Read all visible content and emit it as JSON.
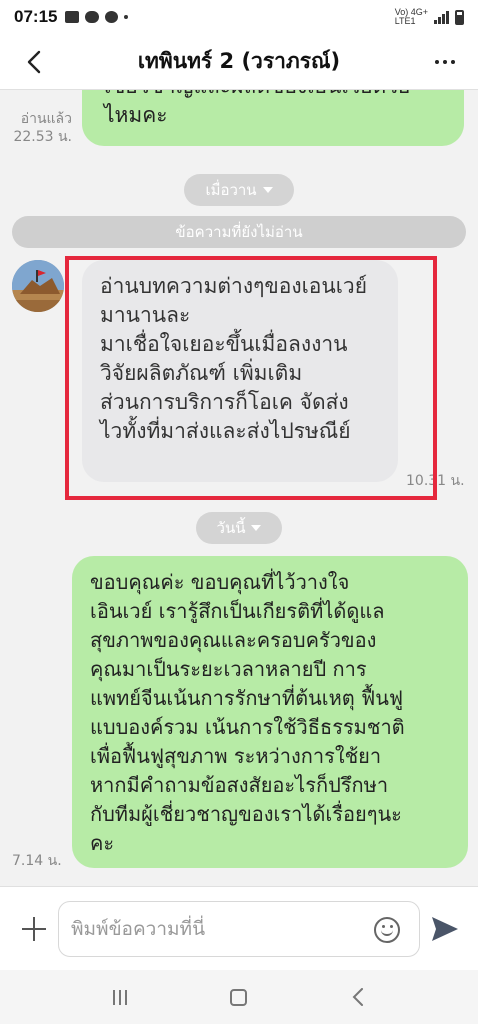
{
  "status_bar": {
    "time": "07:15",
    "network_label": "Vo) 4G+",
    "network_sub": "LTE1"
  },
  "header": {
    "title": "เทพินทร์ 2 (วราภรณ์)"
  },
  "messages": {
    "top_outgoing": {
      "text_line1": "เชี่ยวชาญและผลิตของเอนเวย์ด้วย",
      "text_line2": "ไหมคะ",
      "read_label": "อ่านแล้ว",
      "time": "22.53 น."
    },
    "date_yesterday": "เมื่อวาน",
    "unread_label": "ข้อความที่ยังไม่อ่าน",
    "incoming": {
      "lines": [
        "อ่านบทความต่างๆของเอนเวย์",
        "มานานละ",
        "มาเชื่อใจเยอะขึ้นเมื่อลงงาน",
        "วิจัยผลิตภัณฑ์ เพิ่มเติม",
        "ส่วนการบริการก็โอเค จัดส่ง",
        "ไวทั้งที่มาส่งและส่งไปรษณีย์"
      ],
      "time": "10.31 น."
    },
    "date_today": "วันนี้",
    "outgoing": {
      "lines": [
        "ขอบคุณค่ะ ขอบคุณที่ไว้วางใจ",
        "เอินเวย์ เรารู้สึกเป็นเกียรติที่ได้ดูแล",
        "สุขภาพของคุณและครอบครัวของ",
        "คุณมาเป็นระยะเวลาหลายปี การ",
        "แพทย์จีนเน้นการรักษาที่ต้นเหตุ ฟื้นฟู",
        "แบบองค์รวม เน้นการใช้วิธีธรรมชาติ",
        "เพื่อฟื้นฟูสุขภาพ ระหว่างการใช้ยา",
        "หากมีคำถามข้อสงสัยอะไรก็ปรึกษา",
        "กับทีมผู้เชี่ยวชาญของเราได้เรื่อยๆนะ",
        "คะ"
      ],
      "time": "7.14 น."
    }
  },
  "input": {
    "placeholder": "พิมพ์ข้อความที่นี่"
  },
  "icons": {
    "back": "chevron-left-icon",
    "more": "more-horizontal-icon",
    "plus": "plus-icon",
    "emoji": "smiley-icon",
    "send": "send-icon"
  },
  "colors": {
    "outgoing_bubble": "#b7eba6",
    "incoming_bubble": "#e8e8ea",
    "highlight_box": "#e5283d",
    "send_icon": "#4a5568"
  }
}
